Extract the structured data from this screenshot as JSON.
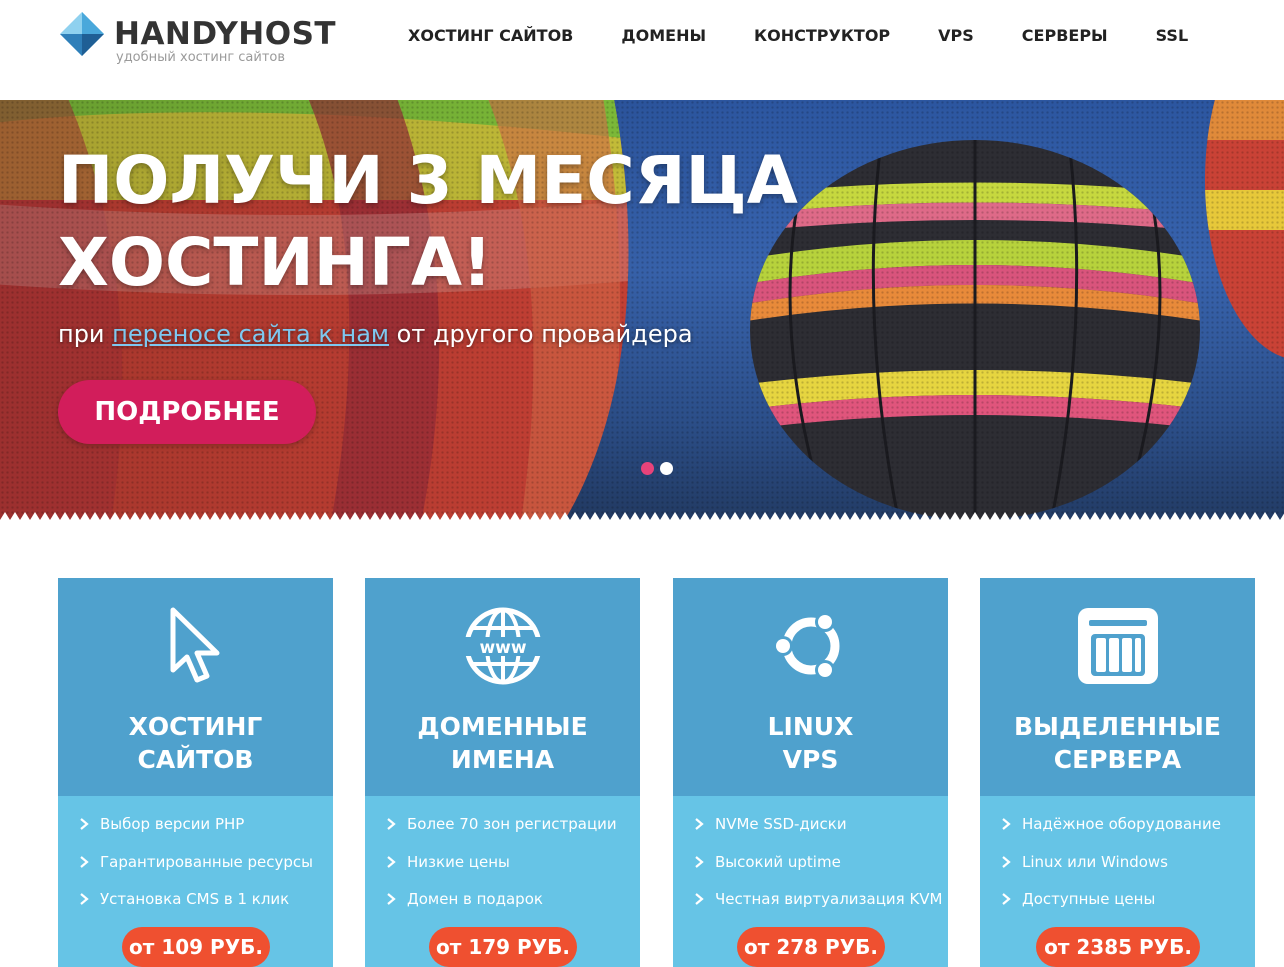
{
  "header": {
    "logo_name": "HANDYHOST",
    "logo_tagline": "удобный хостинг сайтов",
    "nav": [
      {
        "label": "ХОСТИНГ САЙТОВ"
      },
      {
        "label": "ДОМЕНЫ"
      },
      {
        "label": "КОНСТРУКТОР"
      },
      {
        "label": "VPS"
      },
      {
        "label": "СЕРВЕРЫ"
      },
      {
        "label": "SSL"
      }
    ]
  },
  "hero": {
    "title_line1": "ПОЛУЧИ 3 МЕСЯЦА",
    "title_line2": "ХОСТИНГА!",
    "subtitle_before": "при ",
    "subtitle_link": "переносе сайта к нам",
    "subtitle_after": " от другого провайдера",
    "button_label": "ПОДРОБНЕЕ",
    "slides_total": 2,
    "active_slide": 1
  },
  "cards": [
    {
      "icon": "cursor-icon",
      "title_line1": "ХОСТИНГ",
      "title_line2": "САЙТОВ",
      "features": [
        "Выбор версии PHP",
        "Гарантированные ресурсы",
        "Установка CMS в 1 клик"
      ],
      "price": "от 109 РУБ."
    },
    {
      "icon": "www-globe-icon",
      "title_line1": "ДОМЕННЫЕ",
      "title_line2": "ИМЕНА",
      "features": [
        "Более 70 зон регистрации",
        "Низкие цены",
        "Домен в подарок"
      ],
      "price": "от 179 РУБ."
    },
    {
      "icon": "ubuntu-icon",
      "title_line1": "LINUX",
      "title_line2": "VPS",
      "features": [
        "NVMe SSD-диски",
        "Высокий uptime",
        "Честная виртуализация KVM"
      ],
      "price": "от 278 РУБ."
    },
    {
      "icon": "server-icon",
      "title_line1": "ВЫДЕЛЕННЫЕ",
      "title_line2": "СЕРВЕРА",
      "features": [
        "Надёжное оборудование",
        "Linux или Windows",
        "Доступные цены"
      ],
      "price": "от 2385 РУБ."
    }
  ],
  "colors": {
    "accent_pink": "#d21d5b",
    "price_orange": "#ef5030",
    "card_top_blue": "#4fa1cd",
    "card_bottom_blue": "#66c4e6",
    "link_blue": "#7ec8f0"
  }
}
